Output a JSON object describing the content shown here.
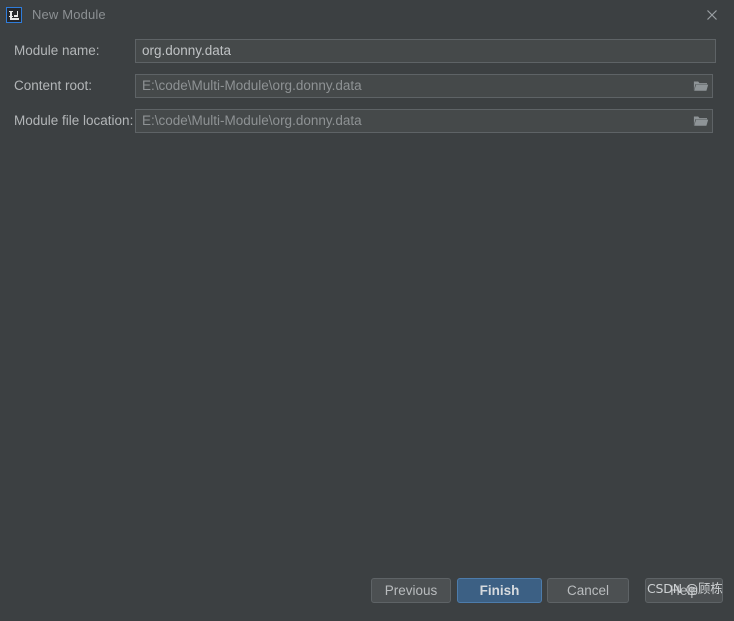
{
  "window": {
    "title": "New Module",
    "app_icon": "intellij-idea-icon",
    "close_icon": "close-icon"
  },
  "form": {
    "fields": [
      {
        "label": "Module name:",
        "value": "org.donny.data",
        "placeholder": "",
        "has_browse": false,
        "state": "active"
      },
      {
        "label": "Content root:",
        "value": "E:\\code\\Multi-Module\\org.donny.data",
        "placeholder": "",
        "has_browse": true,
        "browse_icon": "folder-icon",
        "state": "dim"
      },
      {
        "label": "Module file location:",
        "value": "E:\\code\\Multi-Module\\org.donny.data",
        "placeholder": "",
        "has_browse": true,
        "browse_icon": "folder-icon",
        "state": "dim"
      }
    ]
  },
  "footer": {
    "previous_label": "Previous",
    "finish_label": "Finish",
    "cancel_label": "Cancel",
    "help_label": "Help",
    "watermark_text": "CSDN @顾栋"
  },
  "colors": {
    "dialog_bg": "#3c4042",
    "input_bg": "#45494a",
    "input_border": "#5e6366",
    "label_text": "#b3b6b8",
    "title_text": "#8c9093",
    "button_bg": "#4c5052",
    "accent_blue": "#3c6084",
    "accent_blue_border": "#4d7cab"
  }
}
